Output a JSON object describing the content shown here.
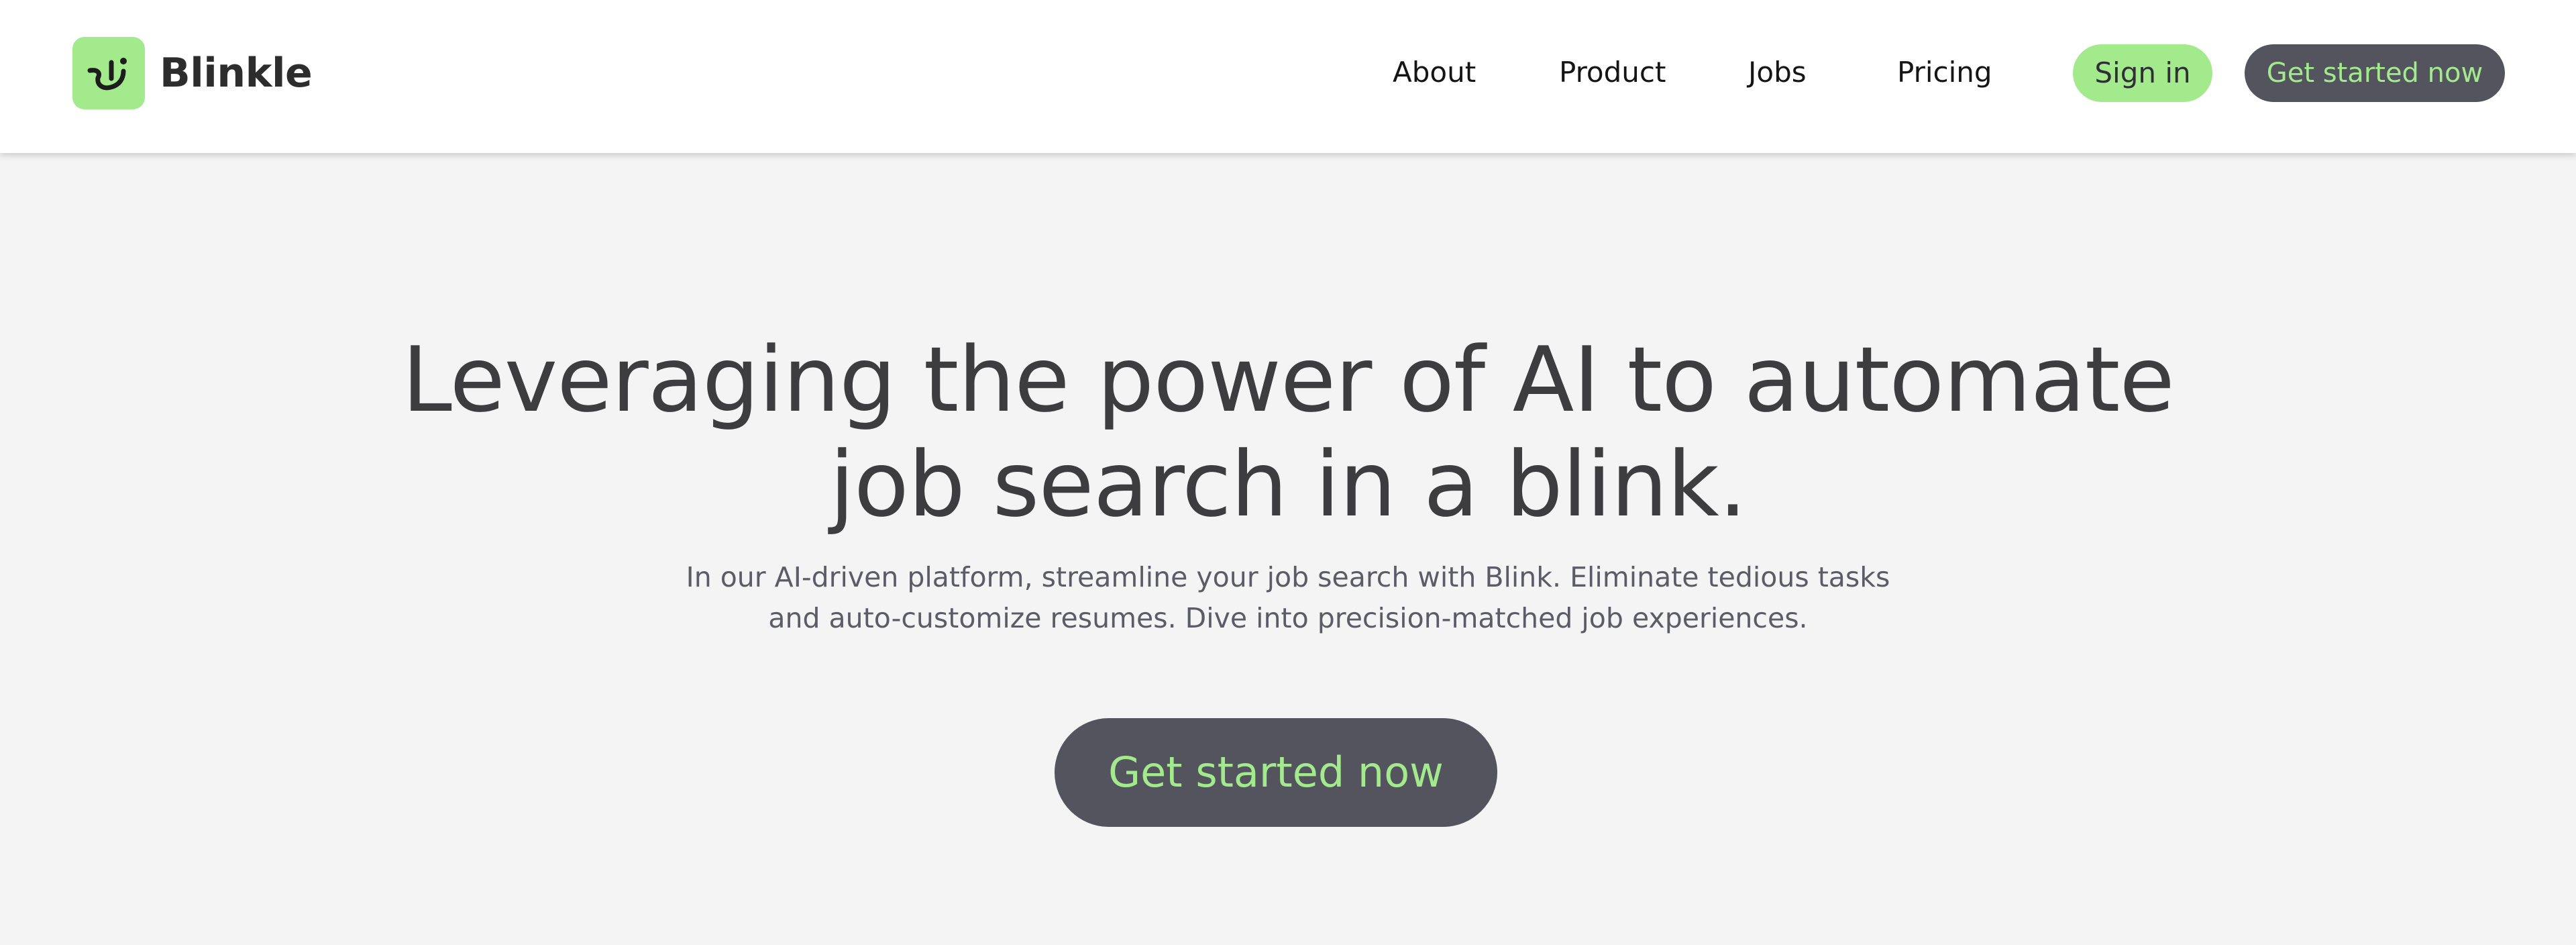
{
  "header": {
    "brand_name": "Blinkle",
    "logo_icon": "blinkle-logo-icon",
    "nav": [
      {
        "label": "About"
      },
      {
        "label": "Product"
      },
      {
        "label": "Jobs"
      },
      {
        "label": "Pricing"
      }
    ],
    "sign_in_label": "Sign in",
    "cta_label": "Get started now"
  },
  "hero": {
    "title": "Leveraging the power of AI to automate job search in a blink.",
    "subtitle": "In our AI-driven platform, streamline your job search with Blink. Eliminate tedious tasks and auto-customize resumes. Dive into precision-matched job experiences.",
    "cta_label": "Get started now"
  },
  "colors": {
    "accent_green": "#a3ea8d",
    "dark_button": "#53545e",
    "page_background": "#f4f4f4",
    "header_background": "#ffffff",
    "heading_text": "#3d3d3f",
    "body_text": "#5b5c66"
  }
}
